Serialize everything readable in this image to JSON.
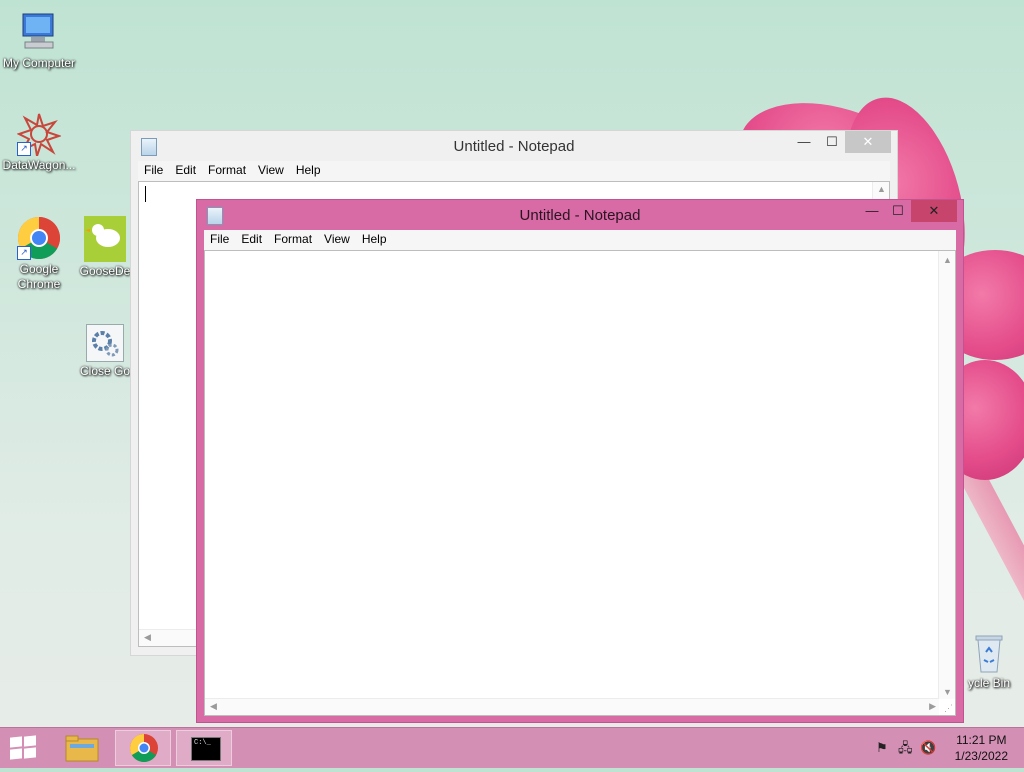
{
  "desktop": {
    "icons": [
      {
        "label": "My Computer",
        "icon": "computer-icon"
      },
      {
        "label": "DataWagon...",
        "icon": "datawagon-icon"
      },
      {
        "label": "Google Chrome",
        "icon": "chrome-icon"
      },
      {
        "label": "GooseDe",
        "icon": "goose-icon"
      },
      {
        "label": "Close Go",
        "icon": "gear-icon"
      },
      {
        "label": "ycle Bin",
        "icon": "recycle-bin-icon"
      }
    ]
  },
  "back_window": {
    "title": "Untitled - Notepad",
    "menu": [
      "File",
      "Edit",
      "Format",
      "View",
      "Help"
    ],
    "min": "—",
    "max": "☐",
    "close": "✕"
  },
  "front_window": {
    "title": "Untitled - Notepad",
    "menu": [
      "File",
      "Edit",
      "Format",
      "View",
      "Help"
    ],
    "min": "—",
    "max": "☐",
    "close": "✕",
    "text": ""
  },
  "taskbar": {
    "items": [
      "start",
      "file-explorer",
      "chrome",
      "command-prompt"
    ],
    "cmd_label": "C:\\_",
    "time": "11:21 PM",
    "date": "1/23/2022"
  },
  "colors": {
    "accent": "#d86aa5",
    "taskbar": "#d48fb4",
    "close_active": "#c7456d"
  }
}
